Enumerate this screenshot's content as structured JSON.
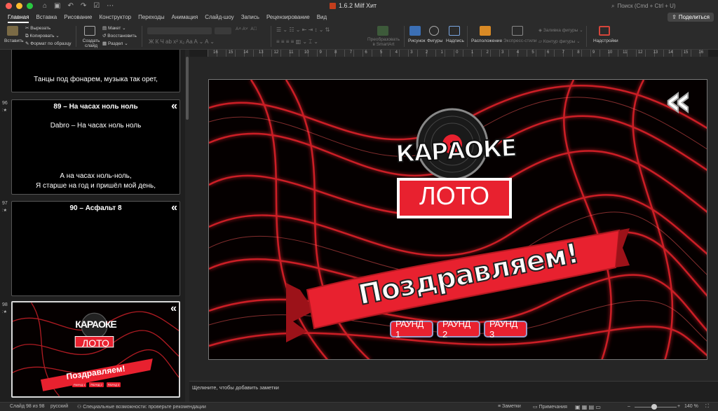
{
  "window": {
    "title": "1.6.2 Milf Хит",
    "search_placeholder": "Поиск (Cmd + Ctrl + U)"
  },
  "tabs": [
    "Главная",
    "Вставка",
    "Рисование",
    "Конструктор",
    "Переходы",
    "Анимация",
    "Слайд-шоу",
    "Запись",
    "Рецензирование",
    "Вид"
  ],
  "share_label": "Поделиться",
  "ribbon": {
    "paste": "Вставить",
    "cut": "Вырезать",
    "copy": "Копировать",
    "format_painter": "Формат по образцу",
    "new_slide": "Создать слайд",
    "layout": "Макет",
    "reset": "Восстановить",
    "section": "Раздел",
    "convert_smartart": "Преобразовать в SmartArt",
    "picture": "Рисунок",
    "shapes": "Фигуры",
    "textbox": "Надпись",
    "arrange": "Расположение",
    "quick_styles": "Экспресс-стили",
    "shape_fill": "Заливка фигуры",
    "shape_outline": "Контур фигуры",
    "addins": "Надстройки"
  },
  "ruler_numbers": [
    "16",
    "15",
    "14",
    "13",
    "12",
    "11",
    "10",
    "9",
    "8",
    "7",
    "6",
    "5",
    "4",
    "3",
    "2",
    "1",
    "0",
    "1",
    "2",
    "3",
    "4",
    "5",
    "6",
    "7",
    "8",
    "9",
    "10",
    "11",
    "12",
    "13",
    "14",
    "15",
    "16"
  ],
  "thumbnails": {
    "s95": {
      "line": "Танцы под фонарем, музыка так орет,"
    },
    "s96": {
      "num": "96",
      "title": "89 – На часах ноль ноль",
      "artist": "Dabro – На часах ноль ноль",
      "line1": "А на часах ноль-ноль,",
      "line2": "Я старше на год и пришёл мой день,"
    },
    "s97": {
      "num": "97",
      "title": "90 – Асфальт 8"
    },
    "s98": {
      "num": "98"
    },
    "chevron": "«"
  },
  "slide": {
    "logo_top": "КАРАОКЕ",
    "logo_bottom": "ЛОТО",
    "banner": "Поздравляем!",
    "rounds": [
      "РАУНД 1",
      "РАУНД 2",
      "РАУНД 3"
    ],
    "back_chevron": "«"
  },
  "notes_placeholder": "Щелкните, чтобы добавить заметки",
  "status": {
    "slide_counter": "Слайд 98 из 98",
    "language": "русский",
    "accessibility": "Специальные возможности: проверьте рекомендации",
    "notes": "Заметки",
    "comments": "Примечания",
    "zoom": "140 %"
  },
  "colors": {
    "accent_red": "#e8212f",
    "ppt_orange": "#c43e1c"
  }
}
